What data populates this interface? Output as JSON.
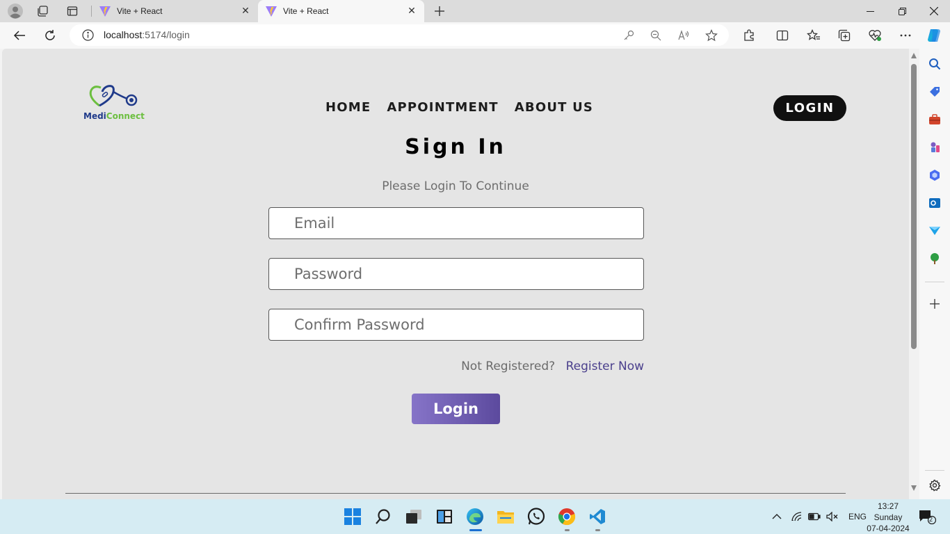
{
  "browser": {
    "tabs": [
      {
        "title": "Vite + React",
        "active": false
      },
      {
        "title": "Vite + React",
        "active": true
      }
    ],
    "url_host": "localhost",
    "url_path": ":5174/login"
  },
  "page": {
    "logo": {
      "part1": "Medi",
      "part2": "Connect"
    },
    "nav": [
      "HOME",
      "APPOINTMENT",
      "ABOUT US"
    ],
    "login_pill": "LOGIN",
    "title": "Sign In",
    "subtitle": "Please Login To Continue",
    "fields": {
      "email_placeholder": "Email",
      "password_placeholder": "Password",
      "confirm_placeholder": "Confirm Password"
    },
    "register_question": "Not Registered?",
    "register_link": "Register Now",
    "login_button": "Login"
  },
  "taskbar": {
    "lang": "ENG",
    "time": "13:27",
    "day": "Sunday",
    "date": "07-04-2024",
    "notifications": "2"
  },
  "colors": {
    "page_bg": "#e5e5e5",
    "accent_start": "#8674c8",
    "accent_end": "#5c4a9e",
    "brand_blue": "#1f3a8a",
    "brand_green": "#6cbf3f"
  }
}
